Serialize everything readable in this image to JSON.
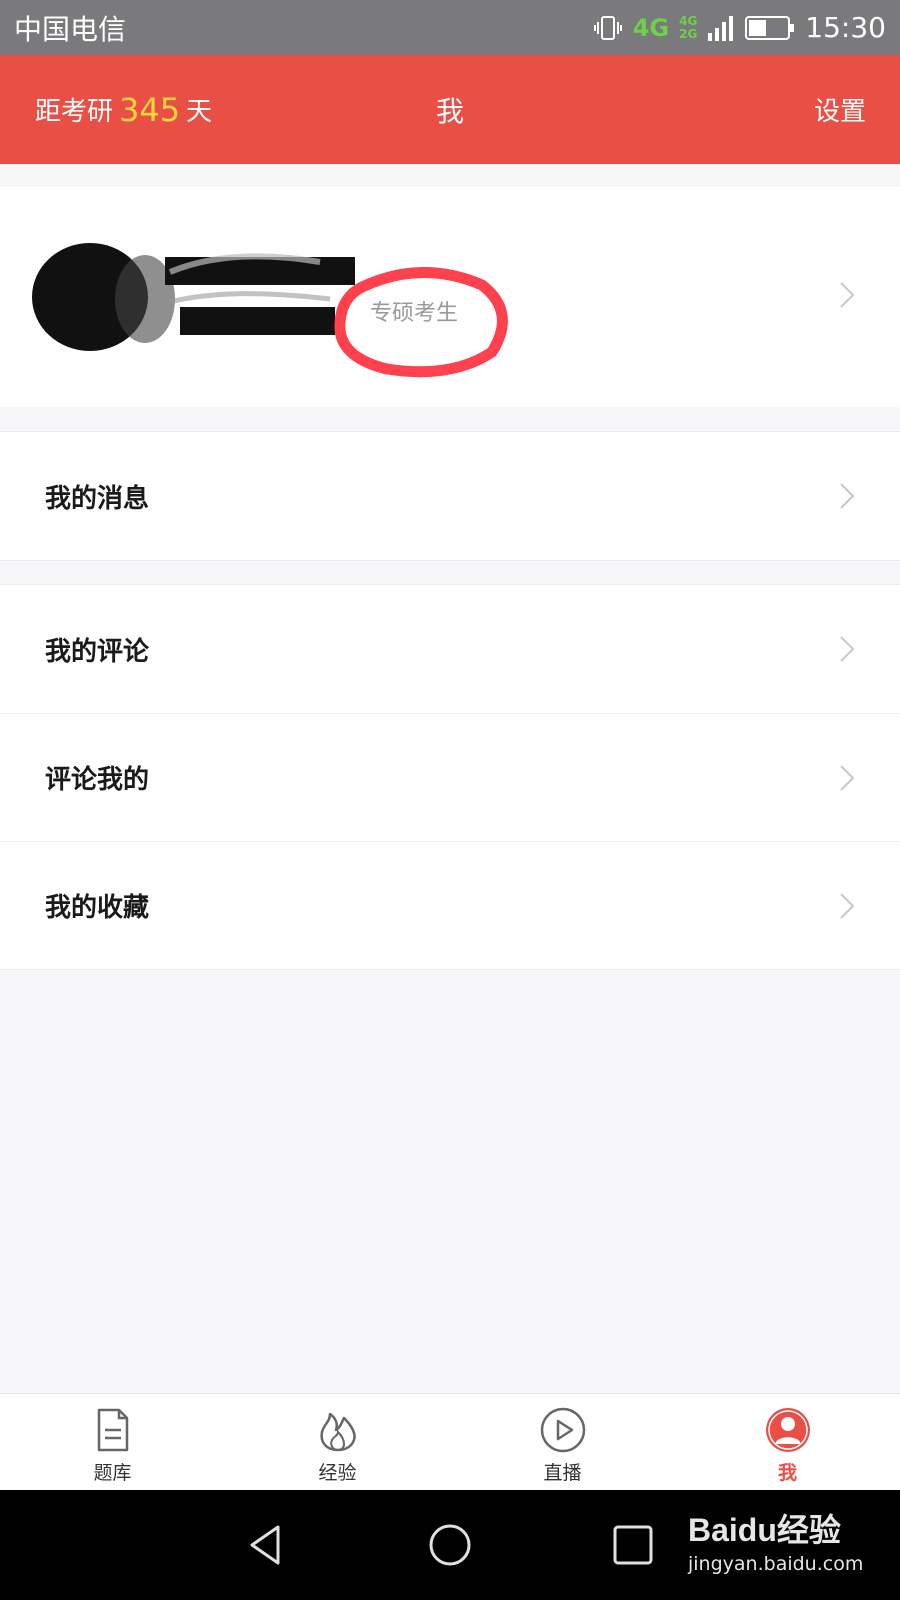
{
  "status_bar": {
    "carrier": "中国电信",
    "network": "4G",
    "network_sub_top": "4G",
    "network_sub_bottom": "2G",
    "time": "15:30"
  },
  "header": {
    "countdown_prefix": "距考研",
    "countdown_days": "345",
    "countdown_suffix": "天",
    "title": "我",
    "settings_label": "设置",
    "accent_color": "#ea4f46",
    "days_color": "#ffd93b"
  },
  "profile": {
    "user_tag": "专硕考生"
  },
  "menu": {
    "messages": "我的消息",
    "my_comments": "我的评论",
    "comments_on_me": "评论我的",
    "favorites": "我的收藏"
  },
  "tabs": [
    {
      "label": "题库",
      "icon": "document-icon"
    },
    {
      "label": "经验",
      "icon": "flame-icon"
    },
    {
      "label": "直播",
      "icon": "play-circle-icon"
    },
    {
      "label": "我",
      "icon": "user-icon",
      "active": true
    }
  ],
  "watermark": {
    "logo": "Baidu经验",
    "url": "jingyan.baidu.com"
  }
}
